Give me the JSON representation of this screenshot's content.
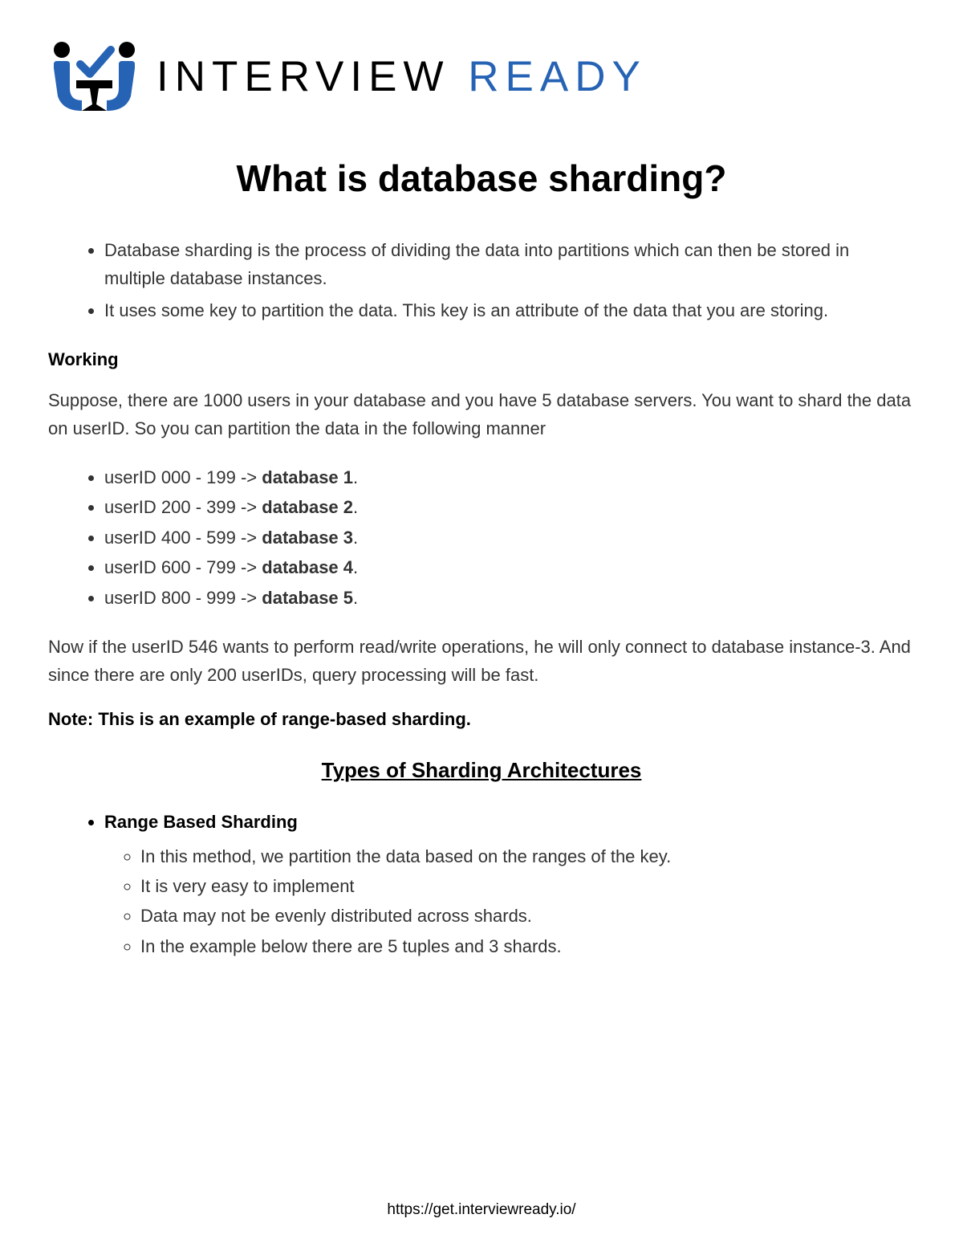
{
  "logo": {
    "word1": "INTERVIEW",
    "word2": "READY"
  },
  "title": "What is database sharding?",
  "intro_bullets": [
    "Database sharding is the process of dividing the data into partitions which can then be stored in multiple database instances.",
    "It uses some key to partition the data. This key is an attribute of the data that you are storing."
  ],
  "working": {
    "heading": "Working",
    "intro": "Suppose, there are 1000 users in your database and you have 5 database servers. You want to shard the data on userID. So you can partition the data in the following manner",
    "mappings": [
      {
        "range": "userID 000 - 199 -> ",
        "target": "database 1",
        "suffix": "."
      },
      {
        "range": "userID 200 - 399 -> ",
        "target": "database 2",
        "suffix": "."
      },
      {
        "range": "userID 400 - 599 -> ",
        "target": "database 3",
        "suffix": "."
      },
      {
        "range": "userID 600 - 799 -> ",
        "target": "database 4",
        "suffix": "."
      },
      {
        "range": "userID 800 - 999 -> ",
        "target": "database 5",
        "suffix": "."
      }
    ],
    "conclusion": "Now if the userID 546 wants to perform read/write operations, he will only connect to database instance-3. And since there are only 200 userIDs, query processing will be fast.",
    "note": "Note: This is an example of range-based sharding."
  },
  "types": {
    "heading": "Types of Sharding Architectures",
    "items": [
      {
        "name": "Range Based Sharding",
        "points": [
          "In this method, we partition the data based on the ranges of the key.",
          "It is very easy to implement",
          "Data may not be evenly distributed across shards.",
          "In the example below there are 5 tuples and 3 shards."
        ]
      }
    ]
  },
  "footer": "https://get.interviewready.io/"
}
